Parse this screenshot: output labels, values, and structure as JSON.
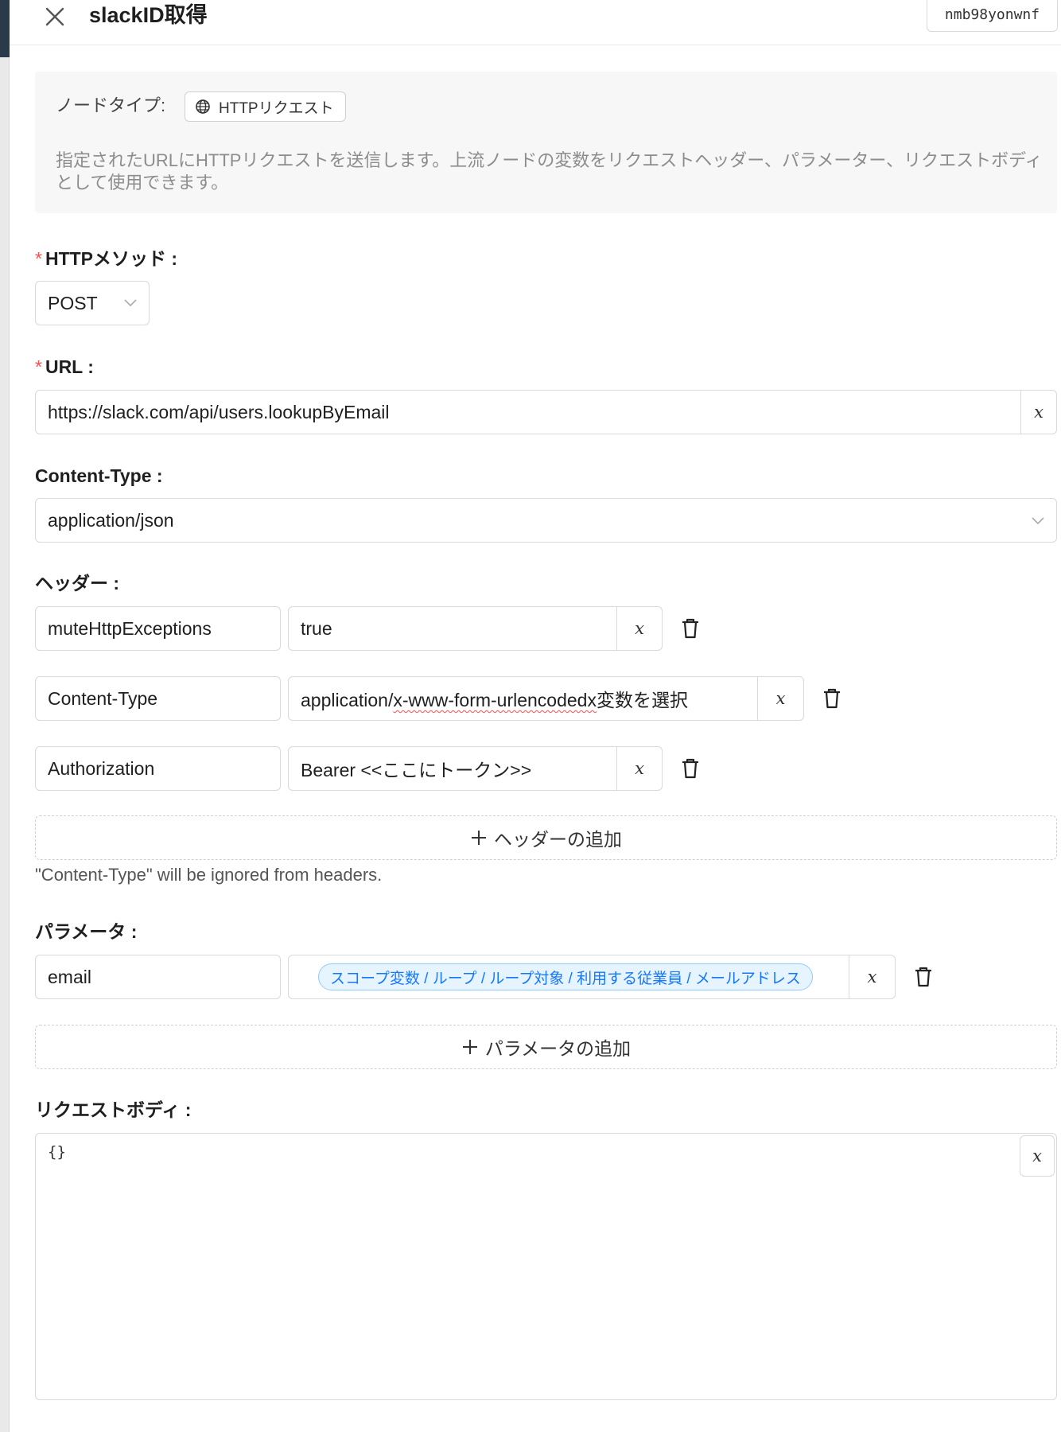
{
  "header": {
    "title": "slackID取得",
    "node_id": "nmb98yonwnf"
  },
  "info": {
    "node_type_label": "ノードタイプ:",
    "node_type_value": "HTTPリクエスト",
    "description": "指定されたURLにHTTPリクエストを送信します。上流ノードの変数をリクエストヘッダー、パラメーター、リクエストボディとして使用できます。"
  },
  "method": {
    "label": "HTTPメソッド :",
    "value": "POST"
  },
  "url": {
    "label": "URL :",
    "value": "https://slack.com/api/users.lookupByEmail",
    "var_button": "x"
  },
  "content_type": {
    "label": "Content-Type :",
    "value": "application/json"
  },
  "headers": {
    "label": "ヘッダー :",
    "rows": [
      {
        "key": "muteHttpExceptions",
        "value": "true",
        "var_button": "x"
      },
      {
        "key": "Content-Type",
        "value_main": "application/",
        "value_underlined": "x-www-form-urlencodedx",
        "value_suffix": "変数を選択",
        "var_button": "x"
      },
      {
        "key": "Authorization",
        "value": "Bearer <<ここにトークン>>",
        "var_button": "x"
      }
    ],
    "add_label": "ヘッダーの追加",
    "note": "\"Content-Type\" will be ignored from headers."
  },
  "params": {
    "label": "パラメータ :",
    "rows": [
      {
        "key": "email",
        "chip": "スコープ変数 / ループ / ループ対象 / 利用する従業員 / メールアドレス",
        "var_button": "x"
      }
    ],
    "add_label": "パラメータの追加"
  },
  "body": {
    "label": "リクエストボディ :",
    "value": "{}",
    "var_button": "x"
  },
  "icons": {
    "close": "close-icon",
    "globe": "globe-icon",
    "chevron": "chevron-down-icon",
    "trash": "trash-icon",
    "plus": "plus-icon"
  },
  "colors": {
    "required": "#ff4d4f",
    "chip_text": "#1677ff",
    "chip_bg": "#e6f4ff"
  }
}
